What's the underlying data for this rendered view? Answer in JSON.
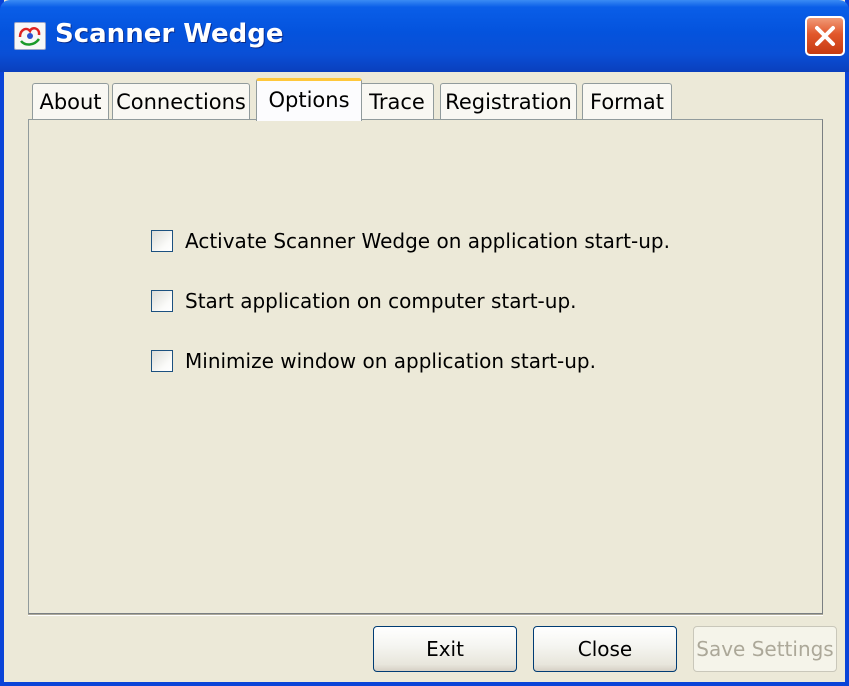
{
  "window": {
    "title": "Scanner Wedge",
    "colors": {
      "titlebar": "#0453dd",
      "face": "#ece9d8",
      "active_tab_accent": "#ffc83c",
      "close_button": "#e2572b"
    }
  },
  "tabs": [
    {
      "label": "About",
      "active": false
    },
    {
      "label": "Connections",
      "active": false
    },
    {
      "label": "Options",
      "active": true
    },
    {
      "label": "Trace",
      "active": false
    },
    {
      "label": "Registration",
      "active": false
    },
    {
      "label": "Format",
      "active": false
    }
  ],
  "options": [
    {
      "label": "Activate Scanner Wedge on application start-up.",
      "checked": false
    },
    {
      "label": "Start application on computer start-up.",
      "checked": false
    },
    {
      "label": "Minimize window on application start-up.",
      "checked": false
    }
  ],
  "buttons": {
    "exit": "Exit",
    "close": "Close",
    "save_settings": "Save Settings",
    "save_settings_enabled": false
  }
}
